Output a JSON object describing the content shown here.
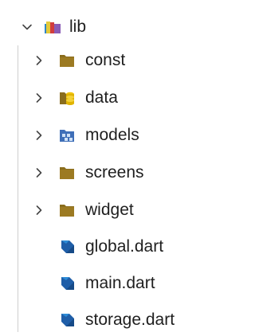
{
  "explorer": {
    "root": {
      "label": "lib",
      "icon": "folder-lib-open-icon",
      "expanded": true
    },
    "items": [
      {
        "label": "const",
        "kind": "folder",
        "icon": "folder-icon",
        "color": "#8a6d1d"
      },
      {
        "label": "data",
        "kind": "folder",
        "icon": "folder-data-icon",
        "color": "#e1b400"
      },
      {
        "label": "models",
        "kind": "folder",
        "icon": "folder-models-icon",
        "color": "#3f6fb8"
      },
      {
        "label": "screens",
        "kind": "folder",
        "icon": "folder-icon",
        "color": "#8a6d1d"
      },
      {
        "label": "widget",
        "kind": "folder",
        "icon": "folder-icon",
        "color": "#8a6d1d"
      },
      {
        "label": "global.dart",
        "kind": "file",
        "icon": "dart-file-icon",
        "color": "#1f5ea8"
      },
      {
        "label": "main.dart",
        "kind": "file",
        "icon": "dart-file-icon",
        "color": "#1f5ea8"
      },
      {
        "label": "storage.dart",
        "kind": "file",
        "icon": "dart-file-icon",
        "color": "#1f5ea8"
      }
    ]
  }
}
